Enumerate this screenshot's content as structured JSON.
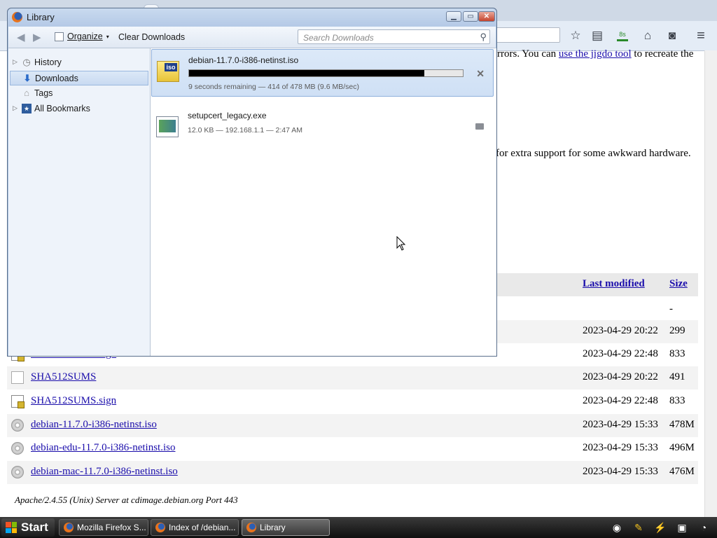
{
  "browser": {
    "toolbar_icons": [
      "star-icon",
      "reading-list-icon",
      "downloads-icon",
      "home-icon",
      "pocket-icon",
      "menu-icon"
    ],
    "download_badge": "8s"
  },
  "webpage": {
    "text_line1_suffix": "rrors.  You can",
    "text_line1_link": "use the jigdo tool",
    "text_line1_end": "to recreate the",
    "text_line2": "for extra support for some awkward hardware.",
    "table_headers": {
      "last_modified": "Last modified",
      "size": "Size"
    },
    "parent_size": "-",
    "rows": [
      {
        "name": "",
        "date": "2023-04-29 20:22",
        "size": "299",
        "icon": "file-icon"
      },
      {
        "name": "SHA256SUMS.sign",
        "date": "2023-04-29 22:48",
        "size": "833",
        "icon": "signature-file-icon"
      },
      {
        "name": "SHA512SUMS",
        "date": "2023-04-29 20:22",
        "size": "491",
        "icon": "file-icon"
      },
      {
        "name": "SHA512SUMS.sign",
        "date": "2023-04-29 22:48",
        "size": "833",
        "icon": "signature-file-icon"
      },
      {
        "name": "debian-11.7.0-i386-netinst.iso",
        "date": "2023-04-29 15:33",
        "size": "478M",
        "icon": "disc-icon"
      },
      {
        "name": "debian-edu-11.7.0-i386-netinst.iso",
        "date": "2023-04-29 15:33",
        "size": "496M",
        "icon": "disc-icon"
      },
      {
        "name": "debian-mac-11.7.0-i386-netinst.iso",
        "date": "2023-04-29 15:33",
        "size": "476M",
        "icon": "disc-icon"
      }
    ],
    "footer": "Apache/2.4.55 (Unix) Server at cdimage.debian.org Port 443"
  },
  "library": {
    "title": "Library",
    "toolbar": {
      "organize": "Organize",
      "clear": "Clear Downloads",
      "search_placeholder": "Search Downloads"
    },
    "sidebar": [
      {
        "label": "History",
        "icon": "history-icon",
        "expandable": true
      },
      {
        "label": "Downloads",
        "icon": "downloads-icon",
        "expandable": false,
        "selected": true
      },
      {
        "label": "Tags",
        "icon": "tag-icon",
        "expandable": false
      },
      {
        "label": "All Bookmarks",
        "icon": "bookmarks-icon",
        "expandable": true
      }
    ],
    "downloads": [
      {
        "filename": "debian-11.7.0-i386-netinst.iso",
        "status": "9 seconds remaining — 414 of 478 MB (9.6 MB/sec)",
        "progress": 0.86,
        "icon_label": "iso"
      },
      {
        "filename": "setupcert_legacy.exe",
        "status": "12.0 KB — 192.168.1.1 — 2:47 AM"
      }
    ]
  },
  "taskbar": {
    "start": "Start",
    "items": [
      {
        "label": "Mozilla Firefox S..."
      },
      {
        "label": "Index of /debian..."
      },
      {
        "label": "Library"
      }
    ]
  }
}
